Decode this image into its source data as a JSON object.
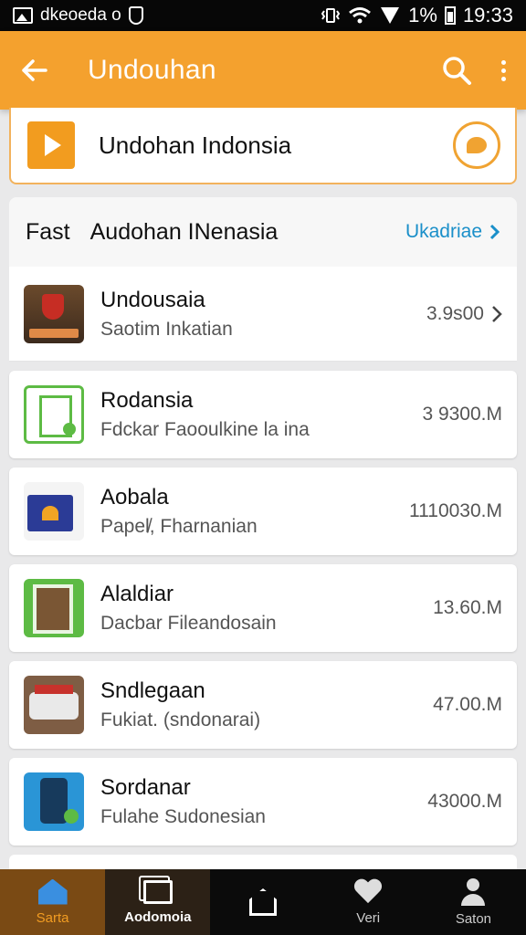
{
  "status_bar": {
    "carrier": "dkeoeda o",
    "battery": "1%",
    "time": "19:33"
  },
  "app_bar": {
    "back_icon": "arrow-left-icon",
    "title": "Undouhan",
    "search_icon": "search-icon",
    "more_icon": "more-vert-icon"
  },
  "feature": {
    "title": "Undohan Indonsia",
    "icon": "play-icon",
    "badge_icon": "chat-icon"
  },
  "section": {
    "prefix": "Fast",
    "title": "Audohan INenasia",
    "link": "Ukadriae"
  },
  "items": [
    {
      "name": "Undousaia",
      "sub": "Saotim Inkatian",
      "size": "3.9s00"
    },
    {
      "name": "Rodansia",
      "sub": "Fdckar Faooulkine la ina",
      "size": "3 9300.M"
    },
    {
      "name": "Aobala",
      "sub": "Papel̸, Fharnanian",
      "size": "1110030.M"
    },
    {
      "name": "Alaldiar",
      "sub": "Dacbar Fileandosain",
      "size": "13.60.M"
    },
    {
      "name": "Sndlegaan",
      "sub": "Fukiat. (sndonarai)",
      "size": "47.00.M"
    },
    {
      "name": "Sordanar",
      "sub": "Fulahe Sudonesian",
      "size": "43000.M"
    }
  ],
  "bottom_nav": [
    {
      "label": "Sarta",
      "icon": "home-icon"
    },
    {
      "label": "Aodomoia",
      "icon": "stack-icon"
    },
    {
      "label": "",
      "icon": "house-outline-icon"
    },
    {
      "label": "Veri",
      "icon": "heart-icon"
    },
    {
      "label": "Saton",
      "icon": "person-icon"
    }
  ],
  "colors": {
    "accent": "#f4a12e",
    "link": "#1a8fc9",
    "nav_active": "#f19c22"
  }
}
